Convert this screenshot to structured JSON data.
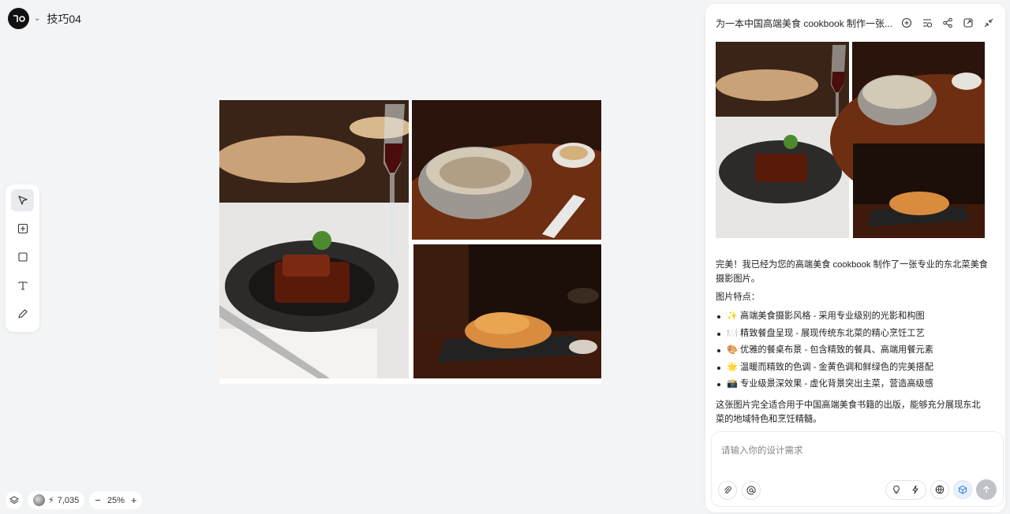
{
  "project": {
    "name": "技巧04",
    "menu_icon": "chevron-down-icon"
  },
  "tools": [
    {
      "name": "select-tool",
      "icon": "cursor-icon"
    },
    {
      "name": "frame-tool",
      "icon": "add-frame-icon"
    },
    {
      "name": "rectangle-tool",
      "icon": "square-icon"
    },
    {
      "name": "text-tool",
      "icon": "text-icon"
    },
    {
      "name": "pen-tool",
      "icon": "pen-icon"
    }
  ],
  "canvas_images": [
    {
      "name": "braised-pork-photo",
      "alt": "red braised pork with wine glass"
    },
    {
      "name": "mushroom-stew-photo",
      "alt": "chicken mushroom stew in clay pot"
    },
    {
      "name": "fried-pork-photo",
      "alt": "sweet and sour fried pork"
    }
  ],
  "bottom_bar": {
    "credits": "7,035",
    "zoom": "25%"
  },
  "panel": {
    "title": "为一本中国高端美食 cookbook 制作一张...",
    "intro": "完美！我已经为您的高端美食 cookbook 制作了一张专业的东北菜美食摄影图片。",
    "features_label": "图片特点：",
    "features": [
      "✨ 高端美食摄影风格 - 采用专业级别的光影和构图",
      "🍽️ 精致餐盘呈现 - 展现传统东北菜的精心烹饪工艺",
      "🎨 优雅的餐桌布景 - 包含精致的餐具、高端用餐元素",
      "🌟 温暖而精致的色调 - 金黄色调和鲜绿色的完美搭配",
      "📸 专业级景深效果 - 虚化背景突出主菜，营造高级感"
    ],
    "outro": "这张图片完全适合用于中国高端美食书籍的出版，能够充分展现东北菜的地域特色和烹饪精髓。",
    "input_placeholder": "请输入你的设计需求"
  }
}
